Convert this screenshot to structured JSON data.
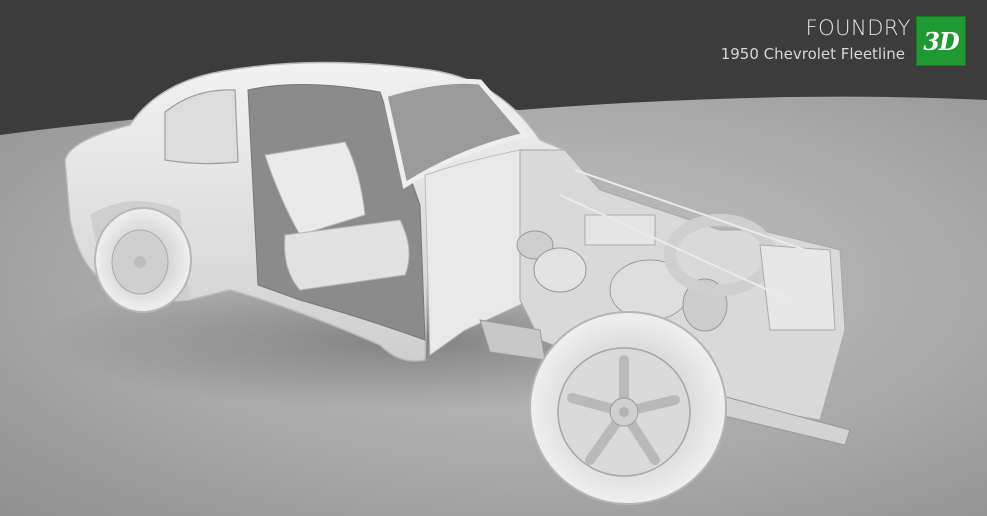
{
  "brand": {
    "title": "FOUNDRY",
    "subtitle": "1950 Chevrolet Fleetline",
    "logo_text": "3D",
    "logo_color": "#1f9a32"
  },
  "scene": {
    "subject": "3d-render-car-chassis",
    "background_color": "#3a3a3a",
    "floor_color": "#a9a9a9"
  }
}
